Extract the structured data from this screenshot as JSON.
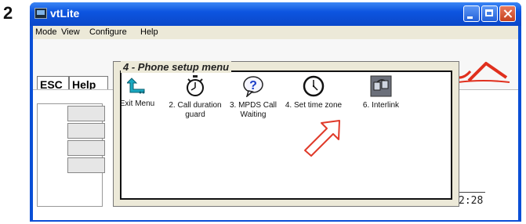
{
  "step_number": "2",
  "window": {
    "title": "vtLite",
    "controls": [
      "minimize-icon",
      "maximize-icon",
      "close-icon"
    ]
  },
  "menubar": {
    "items": [
      "Mode",
      "View",
      "Configure",
      "Help"
    ]
  },
  "toolbar": {
    "esc_label": "ESC",
    "help_label": "Help"
  },
  "dialog": {
    "title": "4 - Phone setup menu",
    "items": [
      {
        "label": "Exit Menu",
        "icon": "back-arrow-icon"
      },
      {
        "label": "2. Call duration guard",
        "icon": "stopwatch-icon"
      },
      {
        "label": "3. MPDS Call Waiting",
        "icon": "question-bubble-icon"
      },
      {
        "label": "4. Set time zone",
        "icon": "clock-icon"
      },
      {
        "label": "6. Interlink",
        "icon": "interlink-icon"
      }
    ]
  },
  "status": {
    "time_fragment": "2:28"
  },
  "colors": {
    "titlebar": "#0a4fd6",
    "window_bg": "#ece9d8",
    "arrow": "#e03a2a",
    "logo_swoosh": "#e0301e"
  }
}
